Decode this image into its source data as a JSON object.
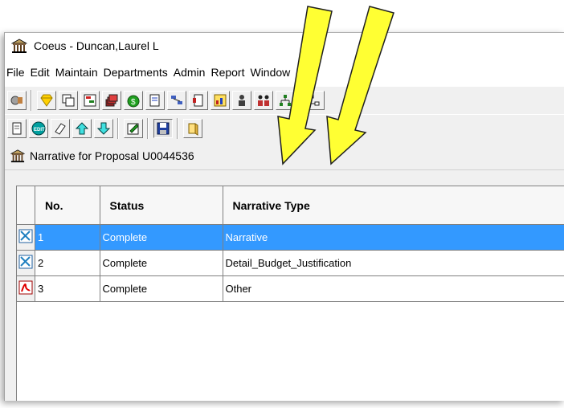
{
  "window": {
    "title": "Coeus -  Duncan,Laurel L"
  },
  "menu": [
    "File",
    "Edit",
    "Maintain",
    "Departments",
    "Admin",
    "Report",
    "Window",
    "He"
  ],
  "toolbar1": {
    "icons": [
      "proposal-icon",
      "diamond-icon",
      "copy-icon",
      "routing-icon",
      "stack-icon",
      "budget-icon",
      "edit-doc-icon",
      "org-icon",
      "narrative-icon",
      "chart-icon",
      "person-icon",
      "people-icon",
      "hierarchy-icon",
      "tree-icon"
    ]
  },
  "toolbar2": {
    "icons": [
      "document-icon",
      "edit-badge-icon",
      "eraser-icon",
      "arrow-up-icon",
      "arrow-down-icon",
      "note-edit-icon",
      "save-icon",
      "folder-open-icon"
    ]
  },
  "child": {
    "title": "Narrative for Proposal  U0044536"
  },
  "grid": {
    "columns": [
      "No.",
      "Status",
      "Narrative Type"
    ],
    "rows": [
      {
        "no": "1",
        "status": "Complete",
        "type": "Narrative",
        "icon": "edit-file-icon",
        "selected": true
      },
      {
        "no": "2",
        "status": "Complete",
        "type": "Detail_Budget_Justification",
        "icon": "edit-file-icon",
        "selected": false
      },
      {
        "no": "3",
        "status": "Complete",
        "type": "Other",
        "icon": "pdf-icon",
        "selected": false
      }
    ]
  },
  "colors": {
    "selection": "#3399ff",
    "arrow": "#ffff00"
  }
}
